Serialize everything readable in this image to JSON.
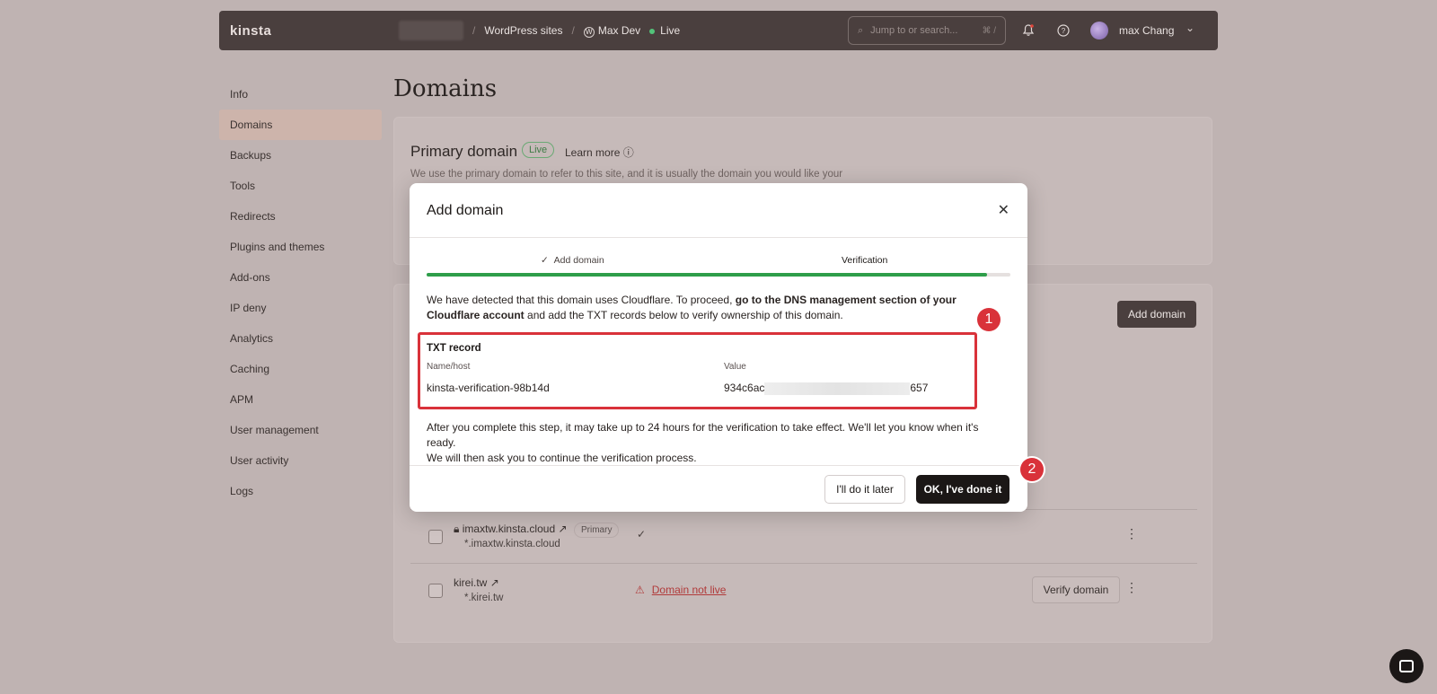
{
  "topbar": {
    "logo": "kinsta",
    "breadcrumb_sites": "WordPress sites",
    "breadcrumb_site": "Max Dev",
    "env": "Live",
    "search_placeholder": "Jump to or search...",
    "search_shortcut": "⌘ /",
    "user_name": "max Chang"
  },
  "sidebar": {
    "items": [
      {
        "label": "Info"
      },
      {
        "label": "Domains",
        "active": true
      },
      {
        "label": "Backups"
      },
      {
        "label": "Tools"
      },
      {
        "label": "Redirects"
      },
      {
        "label": "Plugins and themes"
      },
      {
        "label": "Add-ons"
      },
      {
        "label": "IP deny"
      },
      {
        "label": "Analytics"
      },
      {
        "label": "Caching"
      },
      {
        "label": "APM"
      },
      {
        "label": "User management"
      },
      {
        "label": "User activity"
      },
      {
        "label": "Logs"
      }
    ]
  },
  "main": {
    "title": "Domains",
    "primary": {
      "title": "Primary domain",
      "badge": "Live",
      "learn_more": "Learn more",
      "desc": "We use the primary domain to refer to this site, and it is usually the domain you would like your"
    },
    "add_domain_button": "Add domain",
    "rows": [
      {
        "name": "imaxtw.kinsta.cloud",
        "wildcard": "*.imaxtw.kinsta.cloud",
        "tag": "Primary",
        "status": "✓"
      },
      {
        "name": "kirei.tw",
        "wildcard": "*.kirei.tw",
        "status": "Domain not live",
        "action": "Verify domain"
      }
    ]
  },
  "modal": {
    "title": "Add domain",
    "step1": "Add domain",
    "step2": "Verification",
    "progress": 0.96,
    "intro_plain": "We have detected that this domain uses Cloudflare. To proceed, ",
    "intro_bold": "go to the DNS management section of your Cloudflare account",
    "intro_rest": " and add the TXT records below to verify ownership of this domain.",
    "txt_title": "TXT record",
    "name_label": "Name/host",
    "value_label": "Value",
    "name_value": "kinsta-verification-98b14d",
    "value_start": "934c6ac",
    "value_end": "657",
    "after_1": "After you complete this step, it may take up to 24 hours for the verification to take effect. We'll let you know when it's ready.",
    "after_2": "We will then ask you to continue the verification process.",
    "later_button": "I'll do it later",
    "ok_button": "OK, I've done it"
  },
  "markers": {
    "m1": "1",
    "m2": "2"
  },
  "colors": {
    "accent": "#2e9e4a",
    "highlight": "#d9323a",
    "warning": "#b13b3b"
  }
}
